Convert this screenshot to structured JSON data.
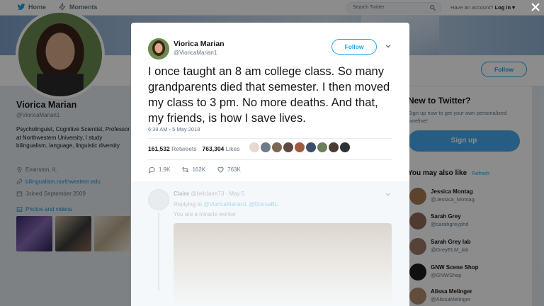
{
  "nav": {
    "home_label": "Home",
    "moments_label": "Moments",
    "search_placeholder": "Search Twitter",
    "have_account_text": "Have an account?",
    "login_label": "Log in ▾"
  },
  "profile": {
    "follow_label": "Follow",
    "name": "Viorica Marian",
    "handle": "@VioricaMarian1",
    "bio": "Psycholinguist, Cognitive Scientist, Professor at Northwestern University, I study bilingualism, language, linguistic diversity",
    "location": "Evanston, IL",
    "website": "bilingualism.northwestern.edu",
    "joined": "Joined September 2009",
    "photos_label": "Photos and videos"
  },
  "new_to_twitter": {
    "title": "New to Twitter?",
    "subtitle": "Sign up now to get your own personalized timeline!",
    "signup_label": "Sign up"
  },
  "who_to_follow": {
    "title": "You may also like",
    "refresh_label": "· Refresh",
    "items": [
      {
        "name": "Jessica Montag",
        "handle": "@Jessica_Montag"
      },
      {
        "name": "Sarah Grey",
        "handle": "@sarahgreyphd"
      },
      {
        "name": "Sarah Grey lab",
        "handle": "@GreyELM_lab"
      },
      {
        "name": "GNW Scene Shop",
        "handle": "@GNWShop"
      },
      {
        "name": "Alissa Melinger",
        "handle": "@AlissaMelinger"
      }
    ]
  },
  "tweet": {
    "author_name": "Viorica Marian",
    "author_handle": "@VioricaMarian1",
    "follow_label": "Follow",
    "text": "I once taught an 8 am college class. So many grandparents died that semester. I then moved my class to 3 pm. No more deaths. And that, my friends, is how I save lives.",
    "timestamp": "6:39 AM - 5 May 2018",
    "retweets_count": "161,532",
    "retweets_label": "Retweets",
    "likes_count": "763,304",
    "likes_label": "Likes",
    "reply_count": "1.9K",
    "retweet_count_short": "162K",
    "like_count_short": "763K"
  },
  "reply": {
    "name": "Claire",
    "handle": "@belclaire73",
    "date": "· May 5",
    "replying_to_label": "Replying to",
    "replying_to_users": "@VioricaMarian1 @DonnaBL",
    "text": "You are a miracle worker"
  },
  "colors": {
    "accent": "#1da1f2",
    "overlay": "rgba(0,0,0,0.45)"
  }
}
